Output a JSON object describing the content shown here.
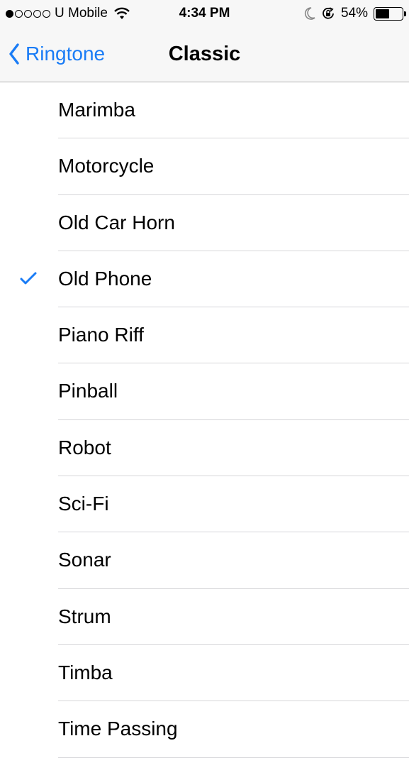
{
  "status_bar": {
    "signal_dots": [
      true,
      false,
      false,
      false,
      false
    ],
    "carrier": "U Mobile",
    "time": "4:34 PM",
    "battery_percent": "54%",
    "battery_level": 0.54,
    "icons": [
      "wifi-icon",
      "moon-icon",
      "rotation-lock-icon",
      "battery-icon"
    ]
  },
  "navbar": {
    "back_label": "Ringtone",
    "title": "Classic"
  },
  "list": {
    "items": [
      {
        "label": "Marimba",
        "checked": false
      },
      {
        "label": "Motorcycle",
        "checked": false
      },
      {
        "label": "Old Car Horn",
        "checked": false
      },
      {
        "label": "Old Phone",
        "checked": true
      },
      {
        "label": "Piano Riff",
        "checked": false
      },
      {
        "label": "Pinball",
        "checked": false
      },
      {
        "label": "Robot",
        "checked": false
      },
      {
        "label": "Sci-Fi",
        "checked": false
      },
      {
        "label": "Sonar",
        "checked": false
      },
      {
        "label": "Strum",
        "checked": false
      },
      {
        "label": "Timba",
        "checked": false
      },
      {
        "label": "Time Passing",
        "checked": false
      }
    ]
  },
  "colors": {
    "accent": "#1a7cf6",
    "header_bg": "#f7f7f7",
    "separator": "#d6d6d9"
  }
}
